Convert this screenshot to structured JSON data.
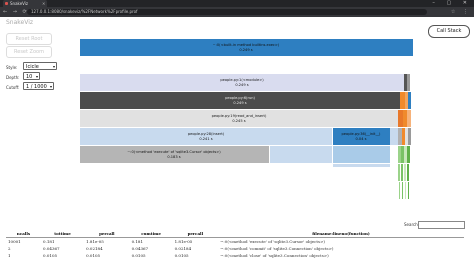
{
  "browser": {
    "tab_title": "SnakeViz",
    "url": "127.0.0.1:8080/snakeviz/%2FNetwork%2Fprofile.prof",
    "window_controls": "– ▢ ✕",
    "nav_icons": "← → ⟳",
    "menu_icons": "☆ ⋮"
  },
  "app": {
    "title": "SnakeViz",
    "reset_root": "Reset Root",
    "reset_zoom": "Reset Zoom",
    "style_label": "Style:",
    "style_value": "Icicle",
    "depth_label": "Depth:",
    "depth_value": "10",
    "cutoff_label": "Cutoff:",
    "cutoff_value": "1 / 1000",
    "call_stack": "Call Stack"
  },
  "icicle": {
    "blocks": [
      {
        "name": "~:0(<built-in method builtins.exec>)",
        "time": "0.249 s",
        "color": "#2e7fc1"
      },
      {
        "name": "people.py:1(<module>)",
        "time": "0.249 s",
        "color": "#d9dcef"
      },
      {
        "name": "people.py:6(run)",
        "time": "0.249 s",
        "color": "#4c4c4c"
      },
      {
        "name": "people.py:19(read_and_insert)",
        "time": "0.245 s",
        "color": "#e1e1e1"
      },
      {
        "name": "people.py:28(insert)",
        "time": "0.241 s",
        "color": "#c8daee"
      },
      {
        "name": "people.py:36(__init__)",
        "time": "0.04 s",
        "color": "#2e7fc1"
      },
      {
        "name": "~:0(<method 'execute' of 'sqlite3.Cursor' objects>)",
        "time": "0.183 s",
        "color": "#b5b5b5"
      }
    ]
  },
  "search": {
    "label": "Search:",
    "value": ""
  },
  "table": {
    "headers": [
      "ncalls",
      "tottime",
      "percall",
      "cumtime",
      "percall",
      "filename:lineno(function)"
    ],
    "rows": [
      [
        "10001",
        "0.181",
        "1.81e-05",
        "0.181",
        "1.81e-05",
        "~:0(<method 'execute' of 'sqlite3.Cursor' objects>)"
      ],
      [
        "2",
        "0.04367",
        "0.02184",
        "0.04367",
        "0.02184",
        "~:0(<method 'commit' of 'sqlite3.Connection' objects>)"
      ],
      [
        "1",
        "0.0105",
        "0.0105",
        "0.0105",
        "0.0105",
        "~:0(<method 'close' of 'sqlite3.Connection' objects>)"
      ]
    ]
  },
  "colors": {
    "accent_blue": "#2e7fc1",
    "orange": "#f08a2c",
    "green": "#9bd38a"
  }
}
